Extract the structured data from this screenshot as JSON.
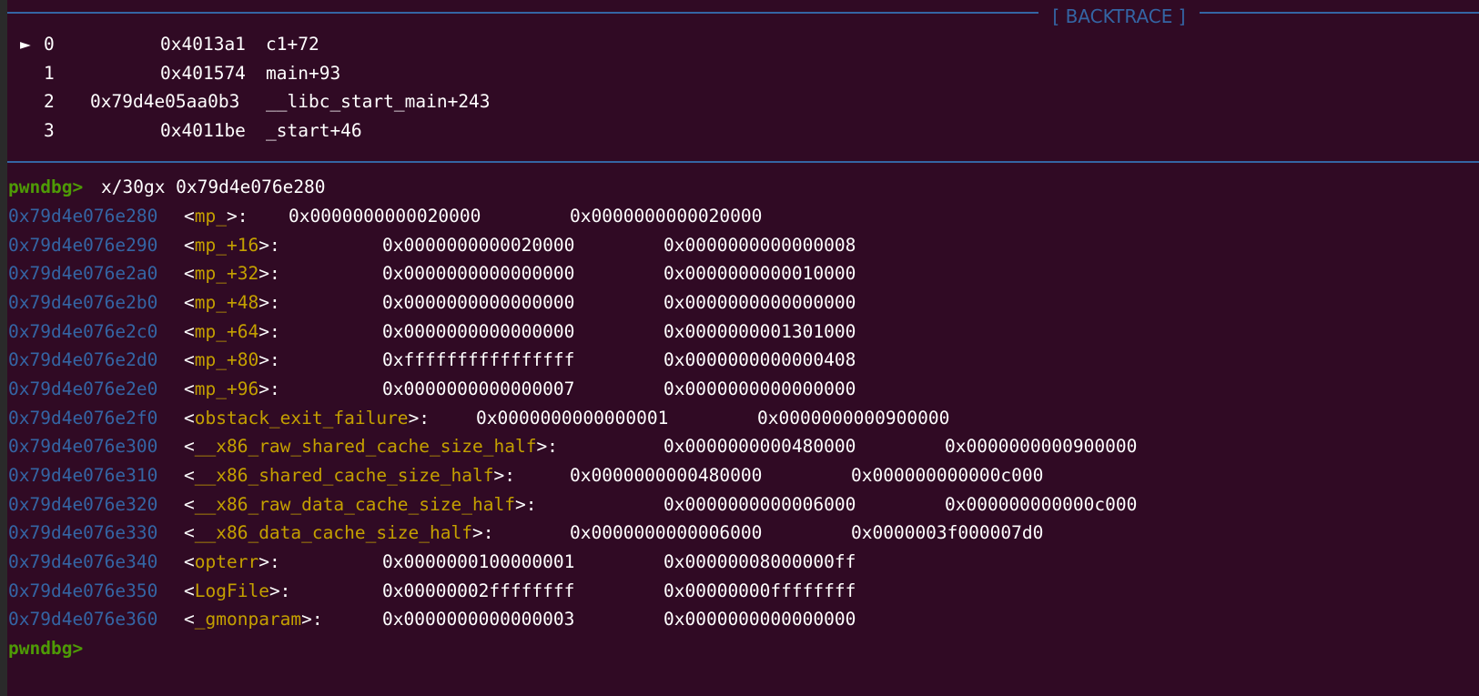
{
  "backtrace": {
    "title": "[ BACKTRACE ]",
    "arrow": "►",
    "frames": [
      {
        "index": "0",
        "address": "0x4013a1",
        "symbol": "c1+72"
      },
      {
        "index": "1",
        "address": "0x401574",
        "symbol": "main+93"
      },
      {
        "index": "2",
        "address": "0x79d4e05aa0b3",
        "symbol": "__libc_start_main+243"
      },
      {
        "index": "3",
        "address": "0x4011be",
        "symbol": "_start+46"
      }
    ]
  },
  "command": {
    "prompt": "pwndbg>",
    "text": "x/30gx 0x79d4e076e280"
  },
  "memory": [
    {
      "address": "0x79d4e076e280",
      "symbol": "mp_",
      "value1": "0x0000000000020000",
      "value2": "0x0000000000020000"
    },
    {
      "address": "0x79d4e076e290",
      "symbol": "mp_+16",
      "value1": "0x0000000000020000",
      "value2": "0x0000000000000008"
    },
    {
      "address": "0x79d4e076e2a0",
      "symbol": "mp_+32",
      "value1": "0x0000000000000000",
      "value2": "0x0000000000010000"
    },
    {
      "address": "0x79d4e076e2b0",
      "symbol": "mp_+48",
      "value1": "0x0000000000000000",
      "value2": "0x0000000000000000"
    },
    {
      "address": "0x79d4e076e2c0",
      "symbol": "mp_+64",
      "value1": "0x0000000000000000",
      "value2": "0x0000000001301000"
    },
    {
      "address": "0x79d4e076e2d0",
      "symbol": "mp_+80",
      "value1": "0xffffffffffffffff",
      "value2": "0x0000000000000408"
    },
    {
      "address": "0x79d4e076e2e0",
      "symbol": "mp_+96",
      "value1": "0x0000000000000007",
      "value2": "0x0000000000000000"
    },
    {
      "address": "0x79d4e076e2f0",
      "symbol": "obstack_exit_failure",
      "value1": "0x0000000000000001",
      "value2": "0x0000000000900000"
    },
    {
      "address": "0x79d4e076e300",
      "symbol": "__x86_raw_shared_cache_size_half",
      "value1": "0x0000000000480000",
      "value2": "0x0000000000900000"
    },
    {
      "address": "0x79d4e076e310",
      "symbol": "__x86_shared_cache_size_half",
      "value1": "0x0000000000480000",
      "value2": "0x000000000000c000"
    },
    {
      "address": "0x79d4e076e320",
      "symbol": "__x86_raw_data_cache_size_half",
      "value1": "0x0000000000006000",
      "value2": "0x000000000000c000"
    },
    {
      "address": "0x79d4e076e330",
      "symbol": "__x86_data_cache_size_half",
      "value1": "0x0000000000006000",
      "value2": "0x0000003f000007d0"
    },
    {
      "address": "0x79d4e076e340",
      "symbol": "opterr",
      "value1": "0x0000000100000001",
      "value2": "0x00000008000000ff"
    },
    {
      "address": "0x79d4e076e350",
      "symbol": "LogFile",
      "value1": "0x00000002ffffffff",
      "value2": "0x00000000ffffffff"
    },
    {
      "address": "0x79d4e076e360",
      "symbol": "_gmonparam",
      "value1": "0x0000000000000003",
      "value2": "0x0000000000000000"
    }
  ],
  "final_prompt": "pwndbg>",
  "colors": {
    "background": "#300a24",
    "prompt": "#4e9a06",
    "address": "#3465a4",
    "symbol": "#c4a000",
    "rule": "#3465a4"
  }
}
